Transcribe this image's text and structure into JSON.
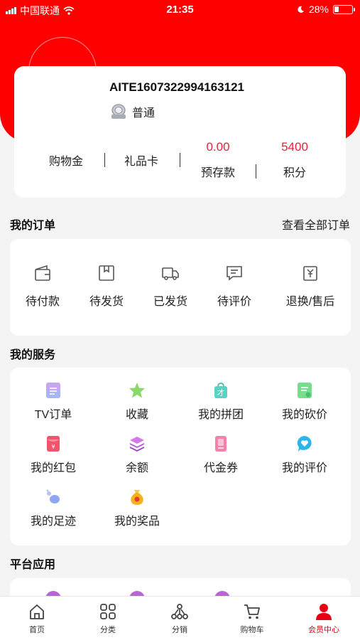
{
  "status_bar": {
    "carrier": "中国联通",
    "time": "21:35",
    "battery": "28%"
  },
  "profile": {
    "user_id": "AITE1607322994163121",
    "level": "普通",
    "stats": [
      {
        "label": "购物金",
        "value": ""
      },
      {
        "label": "礼品卡",
        "value": ""
      },
      {
        "label": "预存款",
        "value": "0.00"
      },
      {
        "label": "积分",
        "value": "5400"
      }
    ]
  },
  "orders": {
    "title": "我的订单",
    "view_all": "查看全部订单",
    "items": [
      {
        "label": "待付款",
        "icon": "wallet-icon"
      },
      {
        "label": "待发货",
        "icon": "box-icon"
      },
      {
        "label": "已发货",
        "icon": "truck-icon"
      },
      {
        "label": "待评价",
        "icon": "comment-icon"
      },
      {
        "label": "退换/售后",
        "icon": "refund-icon"
      }
    ]
  },
  "services": {
    "title": "我的服务",
    "items": [
      {
        "label": "TV订单",
        "icon": "tv-order-icon",
        "color": "#8f9cf2"
      },
      {
        "label": "收藏",
        "icon": "star-icon",
        "color": "#7dd36a"
      },
      {
        "label": "我的拼团",
        "icon": "group-bag-icon",
        "color": "#5ad1c1"
      },
      {
        "label": "我的砍价",
        "icon": "bargain-icon",
        "color": "#6fd68f"
      },
      {
        "label": "我的红包",
        "icon": "red-packet-icon",
        "color": "#f2546c"
      },
      {
        "label": "余额",
        "icon": "layers-icon",
        "color": "#c162e0"
      },
      {
        "label": "代金券",
        "icon": "voucher-icon",
        "color": "#f46aa0"
      },
      {
        "label": "我的评价",
        "icon": "heart-chat-icon",
        "color": "#2ab6ea"
      },
      {
        "label": "我的足迹",
        "icon": "footprint-icon",
        "color": "#7a9cf0"
      },
      {
        "label": "我的奖品",
        "icon": "money-bag-icon",
        "color": "#f5b21d"
      }
    ]
  },
  "platform": {
    "title": "平台应用"
  },
  "tabbar": {
    "items": [
      {
        "label": "首页",
        "icon": "home-icon"
      },
      {
        "label": "分类",
        "icon": "grid-icon"
      },
      {
        "label": "分销",
        "icon": "share-tree-icon"
      },
      {
        "label": "购物车",
        "icon": "cart-icon"
      },
      {
        "label": "会员中心",
        "icon": "member-icon"
      }
    ],
    "active_color": "#e60012"
  }
}
